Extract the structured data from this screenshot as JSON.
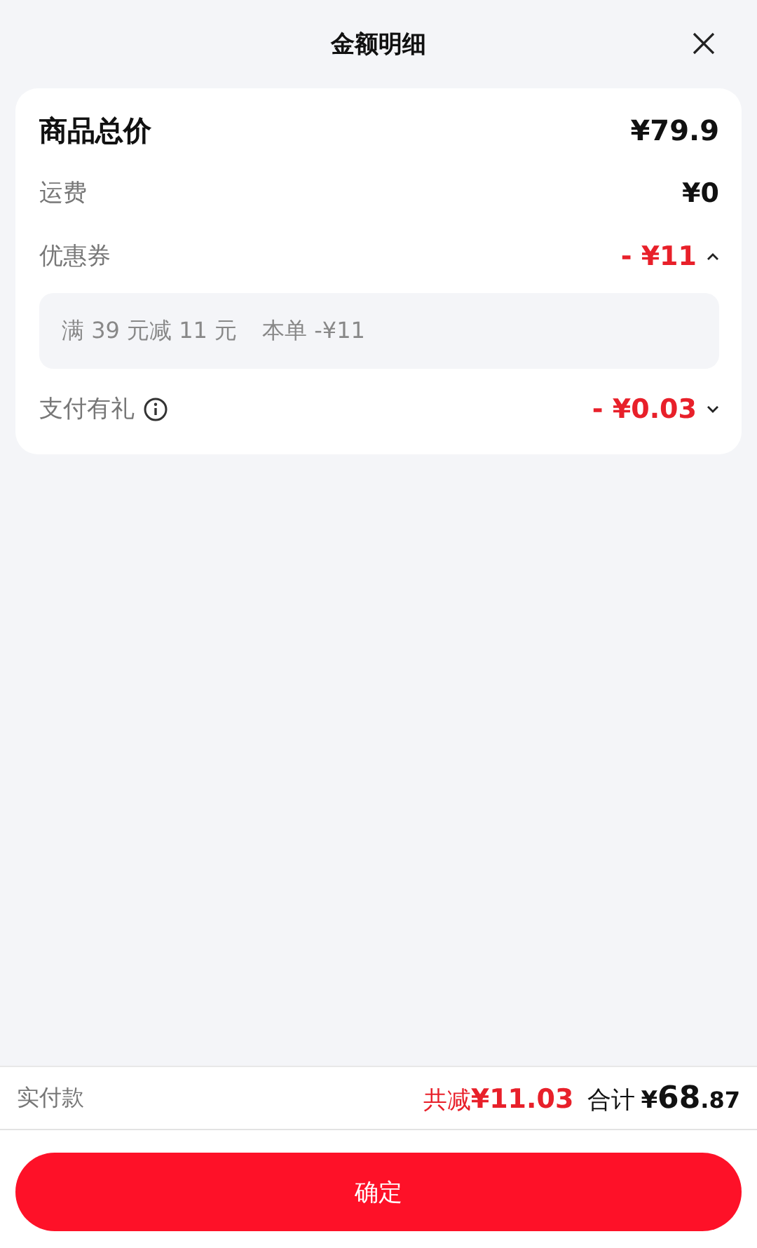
{
  "header": {
    "title": "金额明细"
  },
  "rows": [
    {
      "kind": "total",
      "label": "商品总价",
      "amount": "¥79.9",
      "info": false
    },
    {
      "kind": "plain",
      "label": "运费",
      "amount": "¥0",
      "info": false
    },
    {
      "kind": "discount",
      "label": "优惠券",
      "amount": "- ¥11",
      "info": false,
      "expanded": true,
      "detail": {
        "rule": "满 39 元减 11 元",
        "saving": "本单 -¥11"
      }
    },
    {
      "kind": "discount",
      "label": "支付有礼",
      "amount": "- ¥0.03",
      "info": true,
      "expanded": false
    }
  ],
  "footer": {
    "label": "实付款",
    "saved_label": "共减",
    "saved_amount": "¥11.03",
    "total_label": "合计",
    "currency": "¥",
    "total_integer": "68",
    "total_fraction": ".87"
  },
  "confirm_button": "确定"
}
